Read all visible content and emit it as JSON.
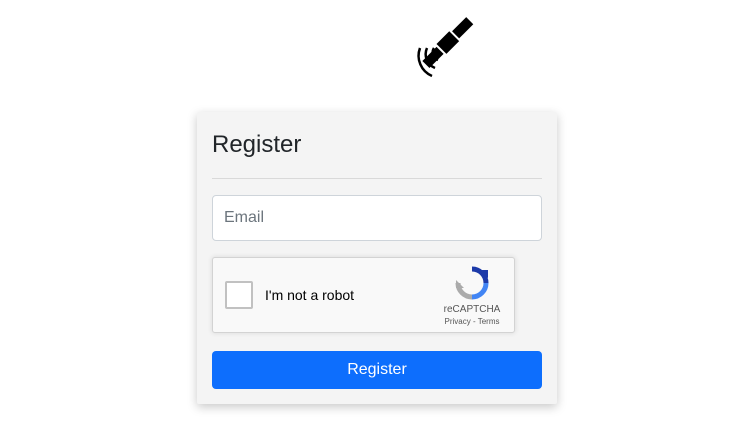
{
  "form": {
    "title": "Register",
    "email_placeholder": "Email",
    "submit_label": "Register"
  },
  "recaptcha": {
    "label": "I'm not a robot",
    "brand": "reCAPTCHA",
    "privacy": "Privacy",
    "separator": " - ",
    "terms": "Terms"
  },
  "icons": {
    "logo": "satellite-icon",
    "recaptcha": "recaptcha-logo-icon"
  },
  "colors": {
    "primary_button": "#0d6efd",
    "card_background": "#f4f4f4"
  }
}
